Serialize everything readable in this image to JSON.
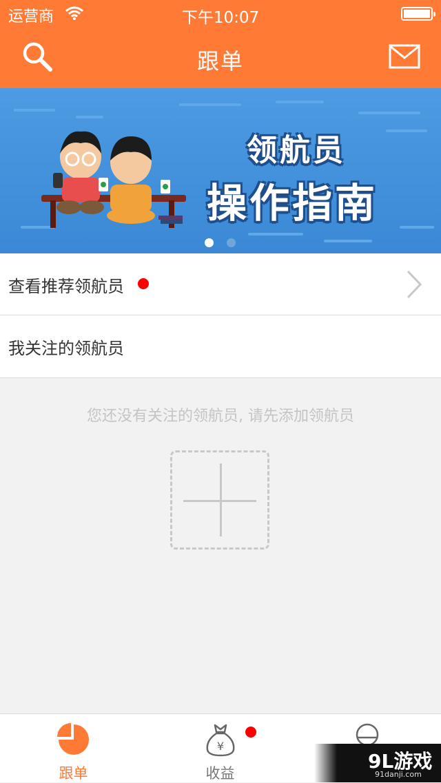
{
  "status_bar": {
    "carrier": "运营商",
    "time": "下午10:07"
  },
  "nav_bar": {
    "title": "跟单",
    "left_icon": "search-icon",
    "right_icon": "mail-icon"
  },
  "banner": {
    "title_line1": "领航员",
    "title_line2": "操作指南",
    "pages": 2,
    "current_page": 1
  },
  "menu": {
    "recommend_label": "查看推荐领航员",
    "recommend_has_badge": true,
    "follow_label": "我关注的领航员"
  },
  "empty_state": {
    "message": "您还没有关注的领航员, 请先添加领航员",
    "add_icon": "plus-icon"
  },
  "tab_bar": {
    "tabs": [
      {
        "label": "跟单",
        "icon": "pie-chart-icon",
        "active": true
      },
      {
        "label": "收益",
        "icon": "money-bag-icon",
        "active": false,
        "badge": true
      },
      {
        "label": "",
        "icon": "profile-icon",
        "active": false
      }
    ]
  },
  "watermark": {
    "main": "9L游戏",
    "sub": "91danji.com"
  },
  "colors": {
    "brand": "#ff7a35",
    "badge": "#ff0000",
    "tab_inactive": "#777777"
  }
}
